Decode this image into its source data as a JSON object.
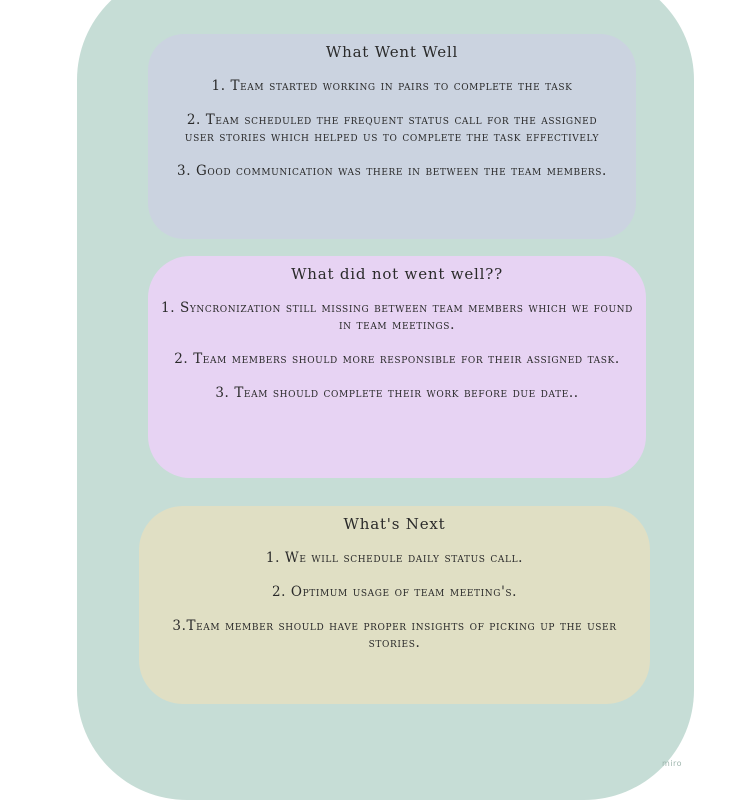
{
  "board": {
    "cards": [
      {
        "title": "What Went Well",
        "items": [
          "1. Team started working in pairs to complete the task",
          "2. Team scheduled the frequent status call for the assigned user stories which helped us to complete the task effectively",
          "3. Good communication was there in between the team members."
        ],
        "color": "#cbd3e0"
      },
      {
        "title": "What did not went well??",
        "items": [
          "1. Syncronization  still missing between team members which we found in team meetings.",
          "2. Team members should more responsible for their assigned task.",
          "3. Team should complete their work before due date.."
        ],
        "color": "#e7d3f3"
      },
      {
        "title": "What's Next",
        "items": [
          "1. We will schedule  daily status call.",
          "2. Optimum usage of team meeting's.",
          "3.Team  member should have proper insights of picking up the user stories."
        ],
        "color": "#e0dfc4"
      }
    ],
    "background_color": "#c6ddd6"
  },
  "watermark": {
    "text": "miro"
  }
}
